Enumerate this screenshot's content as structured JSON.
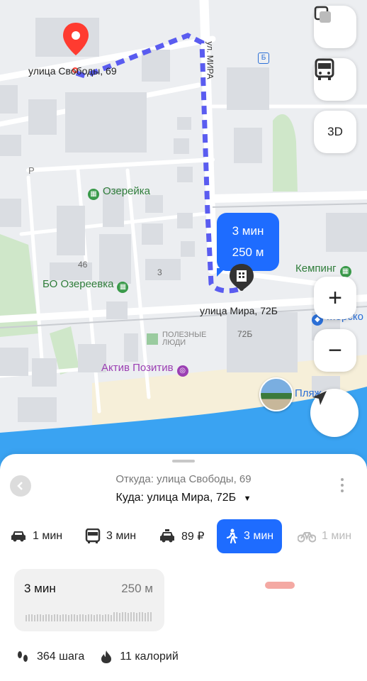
{
  "map": {
    "streets": {
      "mira": "ул. МИРА"
    },
    "addresses": {
      "origin": "улица Свободы, 69",
      "destination": "улица Мира, 72Б"
    },
    "pois": [
      {
        "name": "Озерейка",
        "icon": "hotel-icon"
      },
      {
        "name": "БО Озереевка",
        "icon": "hotel-icon"
      },
      {
        "name": "Кемпинг",
        "icon": "hotel-icon"
      },
      {
        "name": "Актив Позитив",
        "icon": "activity-icon"
      },
      {
        "name": "Морско",
        "icon": "place-icon"
      },
      {
        "name": "Пляж",
        "icon": "beach-photo"
      }
    ],
    "house_numbers": [
      "46",
      "3",
      "72Б"
    ],
    "parking_label": "P",
    "bus_stop_label": "Б",
    "watermark": "ПОЛЕЗНЫЕ ЛЮДИ",
    "bubble": {
      "time": "3 мин",
      "distance": "250 м"
    },
    "buttons": {
      "three_d": "3D",
      "zoom_in": "+",
      "zoom_out": "−"
    }
  },
  "route_panel": {
    "from_label": "Откуда: улица Свободы, 69",
    "to_label": "Куда: улица Мира, 72Б",
    "to_arrow": "▼",
    "modes": [
      {
        "id": "car",
        "icon": "car-icon",
        "label": "1 мин"
      },
      {
        "id": "bus",
        "icon": "bus-icon",
        "label": "3 мин"
      },
      {
        "id": "taxi",
        "icon": "taxi-icon",
        "label": "89 ₽"
      },
      {
        "id": "walk",
        "icon": "walk-icon",
        "label": "3 мин",
        "active": true
      },
      {
        "id": "bike",
        "icon": "bike-icon",
        "label": "1 мин"
      }
    ],
    "route_card": {
      "duration": "3 мин",
      "distance": "250 м"
    },
    "stats": {
      "steps": "364 шага",
      "calories": "11 калорий"
    }
  },
  "colors": {
    "accent": "#1e6cff",
    "route": "#5a5cf0",
    "poi_green": "#3a9a4a",
    "water": "#3aa3f2",
    "beach": "#f6efd9"
  }
}
